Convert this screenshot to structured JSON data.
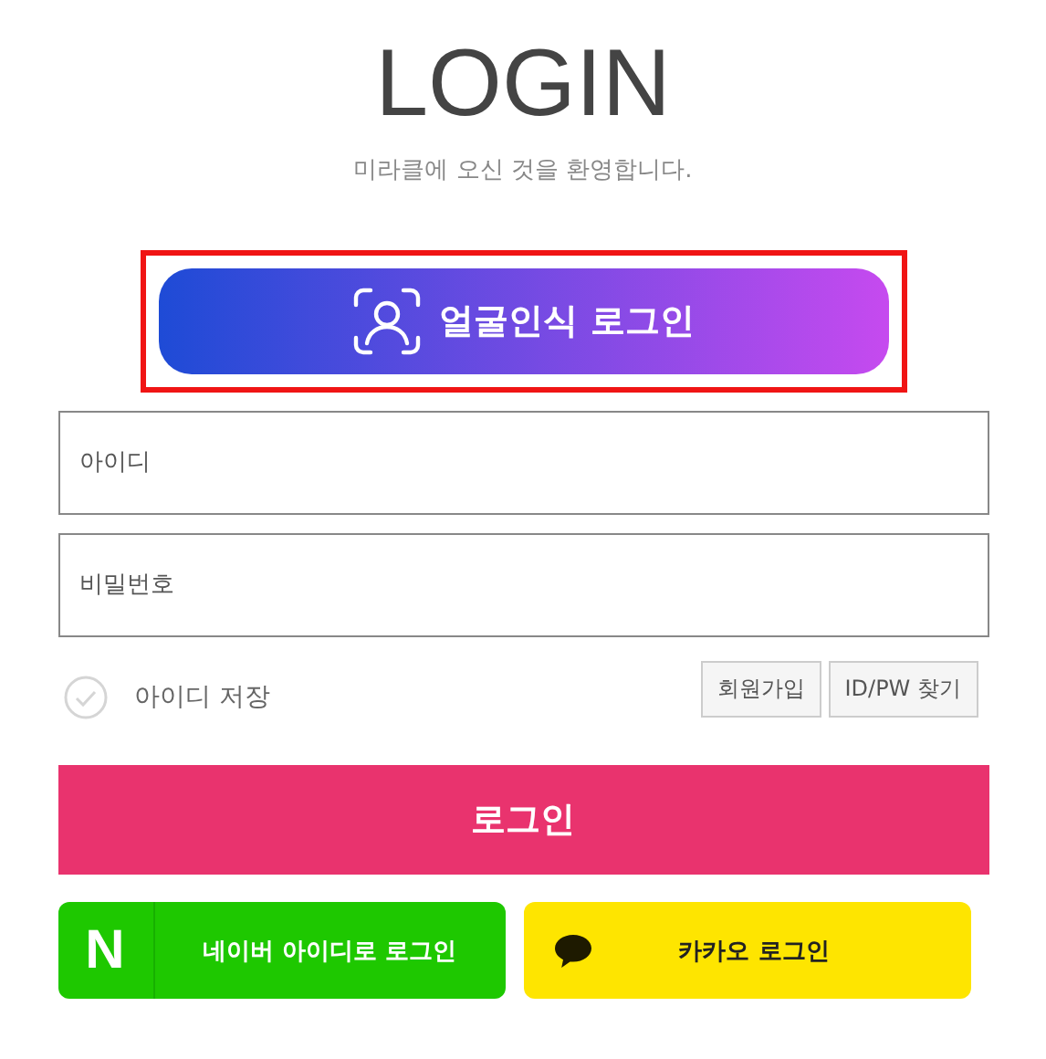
{
  "title": "LOGIN",
  "subtitle": "미라클에 오신 것을 환영합니다.",
  "face_login": {
    "label": "얼굴인식 로그인",
    "highlighted": true
  },
  "fields": [
    {
      "placeholder": "아이디"
    },
    {
      "placeholder": "비밀번호"
    }
  ],
  "remember": {
    "label": "아이디 저장",
    "checked": false
  },
  "links": [
    "회원가입",
    "ID/PW 찾기"
  ],
  "login_button": "로그인",
  "social": [
    {
      "kind": "naver",
      "logo": "N",
      "label": "네이버 아이디로 로그인"
    },
    {
      "kind": "kakao",
      "label": "카카오 로그인"
    }
  ]
}
